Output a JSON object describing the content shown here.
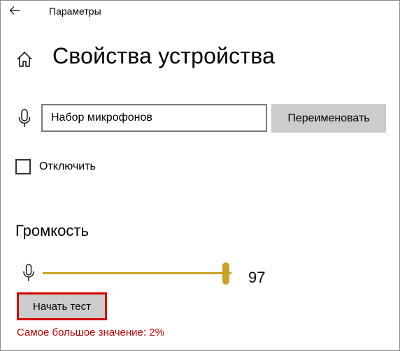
{
  "window": {
    "title": "Параметры"
  },
  "page": {
    "title": "Свойства устройства"
  },
  "device": {
    "name_value": "Набор микрофонов",
    "rename_label": "Переименовать",
    "disable_label": "Отключить",
    "disable_checked": false
  },
  "volume": {
    "heading": "Громкость",
    "level": 97,
    "level_text": "97",
    "max": 100,
    "start_test_label": "Начать тест",
    "max_value_text": "Самое большое значение: 2%"
  },
  "colors": {
    "accent": "#c9a227",
    "highlight_border": "#d40000",
    "warning_text": "#c00000",
    "button_bg": "#cccccc"
  },
  "icons": {
    "back": "back-arrow-icon",
    "home": "home-icon",
    "microphone": "microphone-icon"
  }
}
